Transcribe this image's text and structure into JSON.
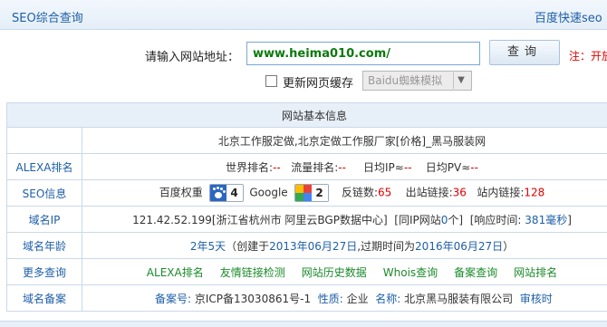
{
  "header": {
    "title": "SEO综合查询",
    "right_link": "百度快速seo"
  },
  "search": {
    "label": "请输入网站地址：",
    "value": "www.heima010.com/",
    "button": "查询",
    "note": "注：开放",
    "checkbox_label": "更新网页缓存",
    "select_value": "Baidu蜘蛛模拟"
  },
  "table": {
    "heading": "网站基本信息",
    "site_title": "北京工作服定做,北京定做工作服厂家[价格]_黑马服装网",
    "alexa": {
      "label": "ALEXA排名",
      "world_label": "世界排名:",
      "world_value": "--",
      "traffic_label": "流量排名:",
      "traffic_value": "--",
      "ip_label": "日均IP≈",
      "ip_value": "--",
      "pv_label": "日均PV≈",
      "pv_value": "--"
    },
    "seo": {
      "label": "SEO信息",
      "baidu_label": "百度权重",
      "baidu_value": "4",
      "google_label": "Google",
      "google_value": "2",
      "backlinks_label": "反链数:",
      "backlinks_value": "65",
      "outlinks_label": "出站链接:",
      "outlinks_value": "36",
      "inlinks_label": "站内链接:",
      "inlinks_value": "128"
    },
    "ip": {
      "label": "域名IP",
      "ip_text": "121.42.52.199",
      "location": "[浙江省杭州市 阿里云BGP数据中心]",
      "same_ip_prefix": "[同IP网站",
      "same_ip_count": "0",
      "same_ip_suffix": "个]",
      "response_prefix": "[响应时间:",
      "response_value": "381毫秒",
      "response_suffix": "]"
    },
    "age": {
      "label": "域名年龄",
      "age_value": "2年5天",
      "created_prefix": "（创建于",
      "created_date": "2013年06月27日",
      "expire_prefix": ",过期时间为",
      "expire_date": "2016年06月27日",
      "expire_suffix": "）"
    },
    "more": {
      "label": "更多查询",
      "links": [
        "ALEXA排名",
        "友情链接检测",
        "网站历史数据",
        "Whois查询",
        "备案查询",
        "网站排名"
      ]
    },
    "icp": {
      "label": "域名备案",
      "number_label": "备案号:",
      "number_value": "京ICP备13030861号-1",
      "nature_label": "性质:",
      "nature_value": "企业",
      "name_label": "名称:",
      "name_value": "北京黑马服装有限公司",
      "audit_label": "审核时"
    }
  }
}
